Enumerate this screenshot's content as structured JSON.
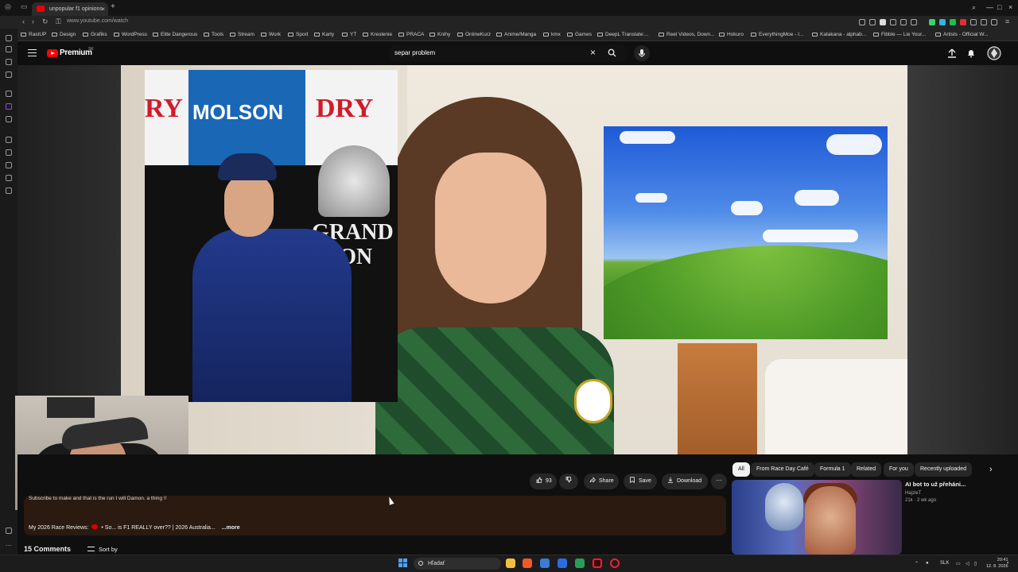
{
  "browser": {
    "tab_title": "unpopular f1 opinions",
    "url": "www.youtube.com/watch",
    "bookmarks": [
      "RastUP",
      "Design",
      "Grafiks",
      "WordPress",
      "Elite Dangerous",
      "Tools",
      "Stream",
      "Work",
      "Sport",
      "Karty",
      "YT",
      "Kreslenie",
      "PRACA",
      "Knihy",
      "OnlineKurz",
      "Anime/Manga",
      "kmx",
      "Games",
      "DeepL Translate:...",
      "Reel Videos, Down...",
      "Hokuro",
      "EverythingMoe - I...",
      "Katakana - alphab...",
      "Fibble — Lie Your...",
      "Artists - Official W..."
    ]
  },
  "header": {
    "logo_text": "Premium",
    "region": "SK",
    "search_value": "separ problem"
  },
  "actions": {
    "likes": "93",
    "share": "Share",
    "save": "Save",
    "download": "Download"
  },
  "description": {
    "line1": "Subscribe to make  and that is the run I will Damon. a thing !!",
    "line2_prefix": "My 2026 Race Reviews:",
    "line2_suffix": "• So... is F1 REALLY over?? | 2026 Australia...",
    "more": "...more"
  },
  "comments": {
    "count_label": "15 Comments",
    "sort_label": "Sort by"
  },
  "chips": [
    "All",
    "From Race Day Café",
    "Formula 1",
    "Related",
    "For you",
    "Recently uploaded"
  ],
  "recommended": {
    "title": "AI bot to už přeháni...",
    "channel": "HajzleT",
    "views": "21k",
    "age": "2 wk ago"
  },
  "taskbar": {
    "search_placeholder": "Hľadať",
    "lang": "SLK",
    "time": "20:41",
    "date": "12. 8. 2026"
  },
  "colors": {
    "accent": "#ff0000",
    "bg": "#0f0f0f",
    "description_bg": "#2a1a10"
  }
}
